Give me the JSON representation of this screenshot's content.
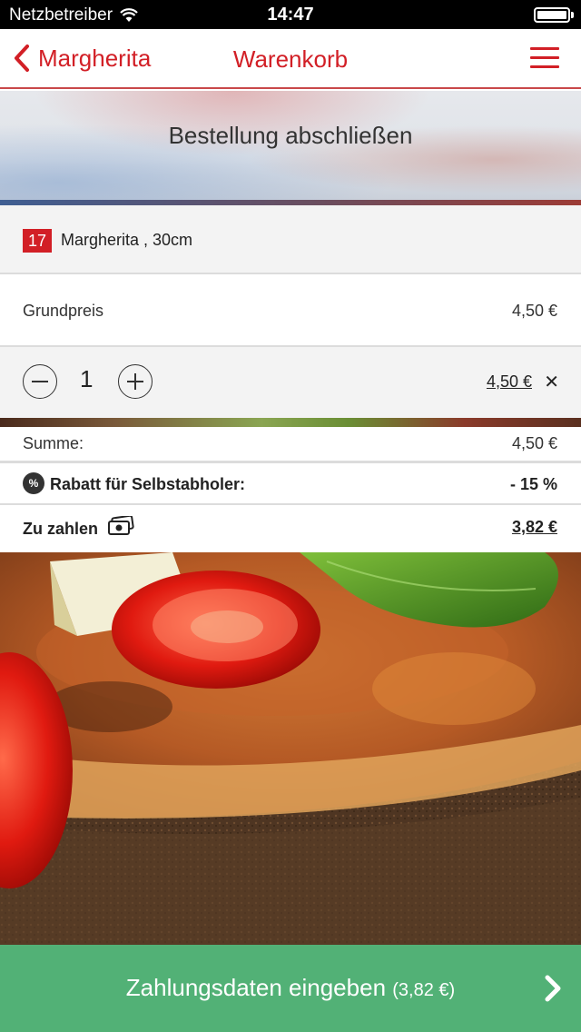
{
  "status_bar": {
    "carrier": "Netzbetreiber",
    "time": "14:47",
    "wifi_icon": "wifi-icon",
    "battery_icon": "battery-icon"
  },
  "navbar": {
    "back_label": "Margherita",
    "title": "Warenkorb",
    "menu_icon": "hamburger-menu-icon"
  },
  "banner": {
    "title": "Bestellung abschließen"
  },
  "item": {
    "number": "17",
    "name": "Margherita , 30cm"
  },
  "base_price": {
    "label": "Grundpreis",
    "value": "4,50 €"
  },
  "quantity": {
    "value": "1",
    "line_price": "4,50 €",
    "remove": "✕"
  },
  "summary": {
    "sum_label": "Summe:",
    "sum_value": "4,50 €",
    "discount_label": "Rabatt für Selbstabholer:",
    "discount_value": "- 15 %",
    "discount_icon_text": "%",
    "total_label": "Zu zahlen",
    "total_value": "3,82 €"
  },
  "cta": {
    "label": "Zahlungsdaten eingeben",
    "amount": "(3,82 €)"
  },
  "colors": {
    "accent": "#d21f26",
    "cta": "#52b176"
  }
}
